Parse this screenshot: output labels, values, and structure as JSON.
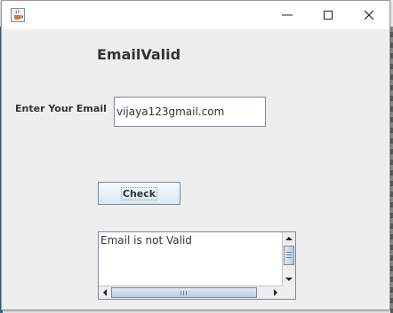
{
  "window": {
    "title": "",
    "icon": "java-cup-icon",
    "controls": [
      "minimize-icon",
      "maximize-icon",
      "close-icon"
    ]
  },
  "form": {
    "heading": "EmailValid",
    "email_label": "Enter Your Email",
    "email_value": "vijaya123gmail.com",
    "check_label": "Check",
    "result_text": "Email is not Valid"
  },
  "colors": {
    "background": "#eeeeee",
    "desktop_edge_left": "#1e6fb3",
    "button_gradient_top": "#f6f9fd",
    "button_gradient_bottom": "#dce7f3",
    "border": "#7a8a99",
    "text": "#333333"
  }
}
